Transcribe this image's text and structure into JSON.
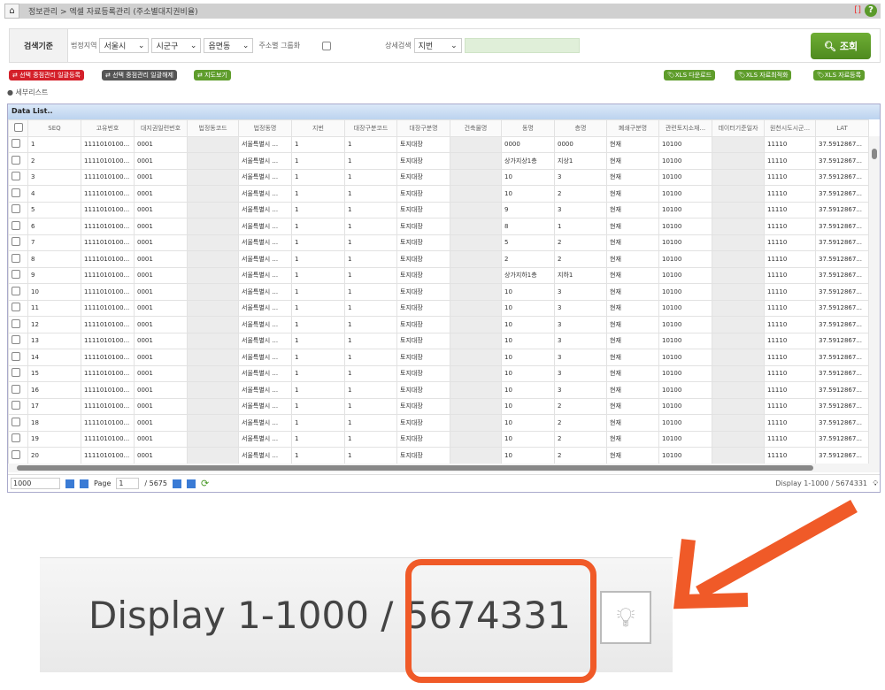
{
  "breadcrumb": "정보관리 > 엑셀 자료등록관리 (주소별대지권비율)",
  "search": {
    "label": "검색기준",
    "region_label": "법정지역",
    "sido": "서울시",
    "sigungu": "시군구",
    "eupmyeondong": "읍면동",
    "group_label": "주소별 그룹화",
    "detail_label": "상세검색",
    "detail_select": "지번",
    "detail_value": "",
    "query_button": "조회"
  },
  "actions": {
    "register": "선택 중점관리 일괄등록",
    "release": "선택 중점관리 일괄해제",
    "map": "지도보기",
    "xls_download": "XLS 다운로드",
    "xls_optimize": "XLS 자료최적화",
    "xls_register": "XLS 자료등록"
  },
  "sublist": "세부리스트",
  "grid": {
    "title": "Data List..",
    "columns": [
      "SEQ",
      "고유번호",
      "대지권일련번호",
      "법정동코드",
      "법정동명",
      "지번",
      "대장구분코드",
      "대장구분명",
      "건축물명",
      "동명",
      "층명",
      "폐쇄구분명",
      "관련토지소재...",
      "데이터기준일자",
      "원천시도시군...",
      "LAT"
    ],
    "rows": [
      [
        "1",
        "1111010100...",
        "0001",
        "",
        "서울특별시 ...",
        "1",
        "1",
        "토지대장",
        "",
        "0000",
        "0000",
        "현재",
        "10100",
        "",
        "11110",
        "37.5912867..."
      ],
      [
        "2",
        "1111010100...",
        "0001",
        "",
        "서울특별시 ...",
        "1",
        "1",
        "토지대장",
        "",
        "상가지상1층",
        "지상1",
        "현재",
        "10100",
        "",
        "11110",
        "37.5912867..."
      ],
      [
        "3",
        "1111010100...",
        "0001",
        "",
        "서울특별시 ...",
        "1",
        "1",
        "토지대장",
        "",
        "10",
        "3",
        "현재",
        "10100",
        "",
        "11110",
        "37.5912867..."
      ],
      [
        "4",
        "1111010100...",
        "0001",
        "",
        "서울특별시 ...",
        "1",
        "1",
        "토지대장",
        "",
        "10",
        "2",
        "현재",
        "10100",
        "",
        "11110",
        "37.5912867..."
      ],
      [
        "5",
        "1111010100...",
        "0001",
        "",
        "서울특별시 ...",
        "1",
        "1",
        "토지대장",
        "",
        "9",
        "3",
        "현재",
        "10100",
        "",
        "11110",
        "37.5912867..."
      ],
      [
        "6",
        "1111010100...",
        "0001",
        "",
        "서울특별시 ...",
        "1",
        "1",
        "토지대장",
        "",
        "8",
        "1",
        "현재",
        "10100",
        "",
        "11110",
        "37.5912867..."
      ],
      [
        "7",
        "1111010100...",
        "0001",
        "",
        "서울특별시 ...",
        "1",
        "1",
        "토지대장",
        "",
        "5",
        "2",
        "현재",
        "10100",
        "",
        "11110",
        "37.5912867..."
      ],
      [
        "8",
        "1111010100...",
        "0001",
        "",
        "서울특별시 ...",
        "1",
        "1",
        "토지대장",
        "",
        "2",
        "2",
        "현재",
        "10100",
        "",
        "11110",
        "37.5912867..."
      ],
      [
        "9",
        "1111010100...",
        "0001",
        "",
        "서울특별시 ...",
        "1",
        "1",
        "토지대장",
        "",
        "상가지하1층",
        "지하1",
        "현재",
        "10100",
        "",
        "11110",
        "37.5912867..."
      ],
      [
        "10",
        "1111010100...",
        "0001",
        "",
        "서울특별시 ...",
        "1",
        "1",
        "토지대장",
        "",
        "10",
        "3",
        "현재",
        "10100",
        "",
        "11110",
        "37.5912867..."
      ],
      [
        "11",
        "1111010100...",
        "0001",
        "",
        "서울특별시 ...",
        "1",
        "1",
        "토지대장",
        "",
        "10",
        "3",
        "현재",
        "10100",
        "",
        "11110",
        "37.5912867..."
      ],
      [
        "12",
        "1111010100...",
        "0001",
        "",
        "서울특별시 ...",
        "1",
        "1",
        "토지대장",
        "",
        "10",
        "3",
        "현재",
        "10100",
        "",
        "11110",
        "37.5912867..."
      ],
      [
        "13",
        "1111010100...",
        "0001",
        "",
        "서울특별시 ...",
        "1",
        "1",
        "토지대장",
        "",
        "10",
        "3",
        "현재",
        "10100",
        "",
        "11110",
        "37.5912867..."
      ],
      [
        "14",
        "1111010100...",
        "0001",
        "",
        "서울특별시 ...",
        "1",
        "1",
        "토지대장",
        "",
        "10",
        "3",
        "현재",
        "10100",
        "",
        "11110",
        "37.5912867..."
      ],
      [
        "15",
        "1111010100...",
        "0001",
        "",
        "서울특별시 ...",
        "1",
        "1",
        "토지대장",
        "",
        "10",
        "3",
        "현재",
        "10100",
        "",
        "11110",
        "37.5912867..."
      ],
      [
        "16",
        "1111010100...",
        "0001",
        "",
        "서울특별시 ...",
        "1",
        "1",
        "토지대장",
        "",
        "10",
        "3",
        "현재",
        "10100",
        "",
        "11110",
        "37.5912867..."
      ],
      [
        "17",
        "1111010100...",
        "0001",
        "",
        "서울특별시 ...",
        "1",
        "1",
        "토지대장",
        "",
        "10",
        "2",
        "현재",
        "10100",
        "",
        "11110",
        "37.5912867..."
      ],
      [
        "18",
        "1111010100...",
        "0001",
        "",
        "서울특별시 ...",
        "1",
        "1",
        "토지대장",
        "",
        "10",
        "2",
        "현재",
        "10100",
        "",
        "11110",
        "37.5912867..."
      ],
      [
        "19",
        "1111010100...",
        "0001",
        "",
        "서울특별시 ...",
        "1",
        "1",
        "토지대장",
        "",
        "10",
        "2",
        "현재",
        "10100",
        "",
        "11110",
        "37.5912867..."
      ],
      [
        "20",
        "1111010100...",
        "0001",
        "",
        "서울특별시 ...",
        "1",
        "1",
        "토지대장",
        "",
        "10",
        "2",
        "현재",
        "10100",
        "",
        "11110",
        "37.5912867..."
      ]
    ]
  },
  "pager": {
    "page_size": "1000",
    "page_label": "Page",
    "page": "1",
    "total_pages": "/ 5675",
    "display": "Display 1-1000 / 5674331"
  },
  "callout": {
    "display_prefix": "Display 1-1000 / ",
    "total": "5674331",
    "highlight_color": "#f05a28"
  }
}
